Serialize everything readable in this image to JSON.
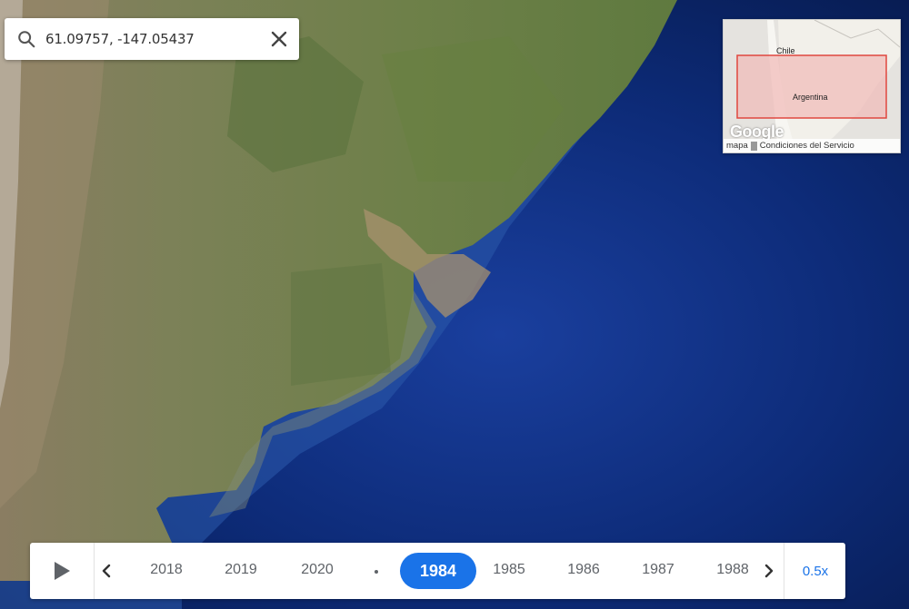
{
  "search": {
    "value": "61.09757, -147.05437",
    "search_icon": "search-icon",
    "clear_icon": "close-icon"
  },
  "minimap": {
    "label_chile": "Chile",
    "label_argentina": "Argentina",
    "footer_map": "mapa",
    "footer_terms": "Condiciones del Servicio",
    "logo": "Google"
  },
  "timeline": {
    "play_icon": "play-icon",
    "prev_icon": "chevron-left-icon",
    "next_icon": "chevron-right-icon",
    "years_before": [
      "2018",
      "2019",
      "2020"
    ],
    "active_year": "1984",
    "years_after": [
      "1985",
      "1986",
      "1987",
      "1988"
    ],
    "speed": "0.5x"
  },
  "colors": {
    "accent": "#1a73e8",
    "ocean": "#0b2a78",
    "land": "#6d7c4c"
  }
}
